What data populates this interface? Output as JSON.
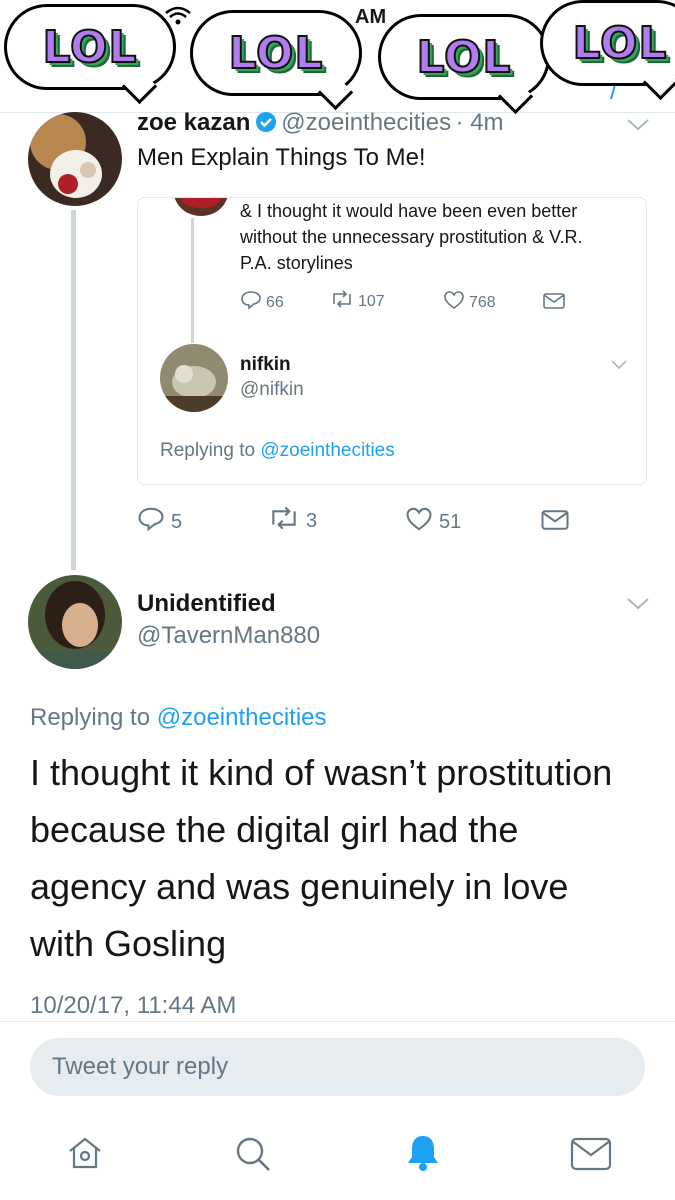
{
  "status_bar": {
    "time": "AM"
  },
  "nav": {
    "title": "et"
  },
  "stickers": [
    "LOL",
    "LOL",
    "LOL",
    "LOL"
  ],
  "tweet1": {
    "name": "zoe kazan",
    "handle": "@zoeinthecities",
    "time": "· 4m",
    "text": "Men Explain Things To Me!",
    "quote": {
      "text": "& I thought it would have been even better without the unnecessary prostitution & V.R. P.A. storylines",
      "replies": "66",
      "retweets": "107",
      "likes": "768",
      "reply_user": {
        "name": "nifkin",
        "handle": "@nifkin",
        "replying_prefix": "Replying to",
        "replying_to": "@zoeinthecities"
      }
    },
    "replies": "5",
    "retweets": "3",
    "likes": "51"
  },
  "tweet2": {
    "name": "Unidentified",
    "handle": "@TavernMan880",
    "replying_prefix": "Replying to",
    "replying_to": "@zoeinthecities",
    "text_lines": [
      "I thought it kind of wasn’t prostitution",
      "because the digital girl had the",
      "agency and was genuinely in love",
      "with Gosling"
    ],
    "timestamp": "10/20/17, 11:44 AM"
  },
  "reply_box": {
    "placeholder": "Tweet your reply"
  },
  "tabbar": {
    "icons": [
      "home-icon",
      "search-icon",
      "notifications-bell-icon",
      "messages-envelope-icon"
    ]
  },
  "colors": {
    "link": "#1da1f2",
    "secondary": "#657786",
    "verified": "#1da1f2",
    "active_tab": "#1da1f2"
  }
}
